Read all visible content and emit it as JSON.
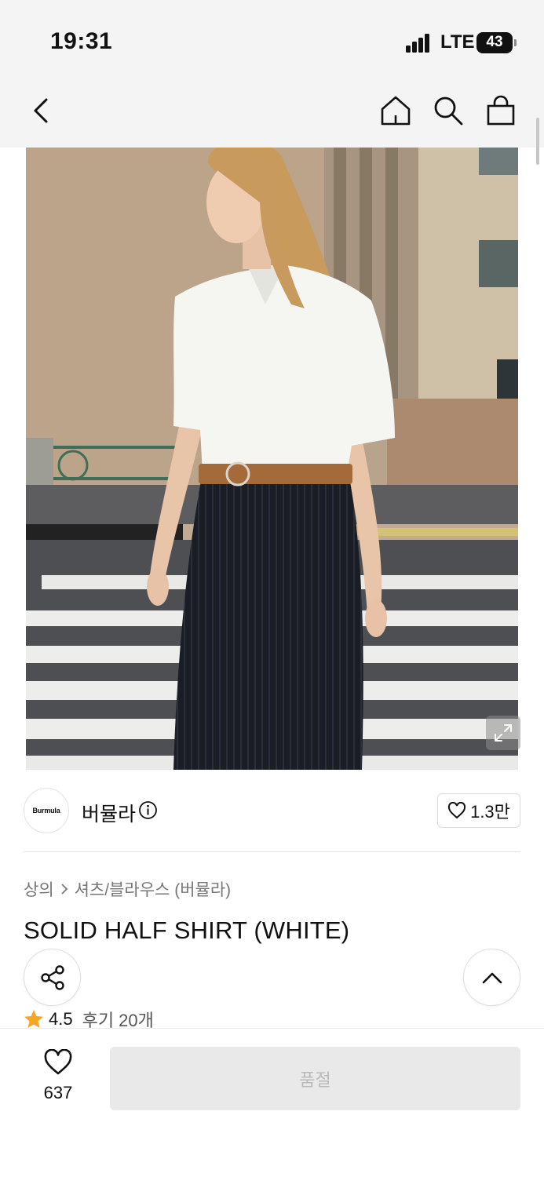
{
  "status_bar": {
    "time": "19:31",
    "network": "LTE",
    "battery": "43"
  },
  "nav": {
    "back_icon": "chevron-left-icon",
    "home_icon": "home-icon",
    "search_icon": "search-icon",
    "cart_icon": "shopping-bag-icon"
  },
  "brand": {
    "logo_text": "Burmula",
    "name": "버뮬라",
    "likes": "1.3만"
  },
  "breadcrumb": {
    "category": "상의",
    "subcategory": "셔츠/블라우스 (버뮬라)"
  },
  "product": {
    "title": "SOLID HALF SHIRT (WHITE)",
    "rating": "4.5",
    "reviews": "후기 20개"
  },
  "bottom_bar": {
    "wish_count": "637",
    "soldout_label": "품절"
  },
  "colors": {
    "background": "#ffffff",
    "status_bg": "#f4f4f4",
    "star": "#f5a623",
    "soldout_bg": "#e9e9e9",
    "soldout_text": "#b9b9b9"
  }
}
